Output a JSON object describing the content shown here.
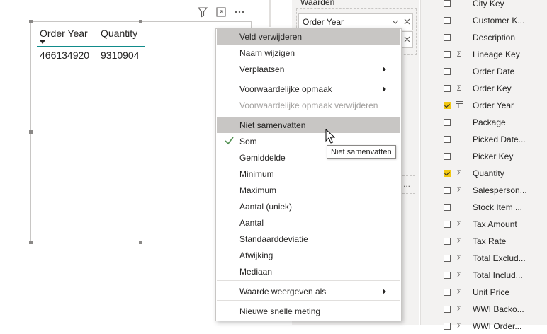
{
  "visual": {
    "columns": [
      "Order Year",
      "Quantity"
    ],
    "row": [
      "466134920",
      "9310904"
    ],
    "toolbar_icons": [
      "filter-icon",
      "focus-mode-icon",
      "more-options-icon"
    ]
  },
  "wells": {
    "section_label": "Waarden",
    "fields": [
      "Order Year",
      ""
    ],
    "drop_hint": "..."
  },
  "fields_pane": {
    "items": [
      {
        "name": "City Key",
        "checked": false,
        "type": ""
      },
      {
        "name": "Customer K...",
        "checked": false,
        "type": ""
      },
      {
        "name": "Description",
        "checked": false,
        "type": ""
      },
      {
        "name": "Lineage Key",
        "checked": false,
        "type": "Σ"
      },
      {
        "name": "Order Date",
        "checked": false,
        "type": ""
      },
      {
        "name": "Order Key",
        "checked": false,
        "type": "Σ"
      },
      {
        "name": "Order Year",
        "checked": true,
        "type": "table"
      },
      {
        "name": "Package",
        "checked": false,
        "type": ""
      },
      {
        "name": "Picked Date...",
        "checked": false,
        "type": ""
      },
      {
        "name": "Picker Key",
        "checked": false,
        "type": ""
      },
      {
        "name": "Quantity",
        "checked": true,
        "type": "Σ"
      },
      {
        "name": "Salesperson...",
        "checked": false,
        "type": "Σ"
      },
      {
        "name": "Stock Item ...",
        "checked": false,
        "type": ""
      },
      {
        "name": "Tax Amount",
        "checked": false,
        "type": "Σ"
      },
      {
        "name": "Tax Rate",
        "checked": false,
        "type": "Σ"
      },
      {
        "name": "Total Exclud...",
        "checked": false,
        "type": "Σ"
      },
      {
        "name": "Total Includ...",
        "checked": false,
        "type": "Σ"
      },
      {
        "name": "Unit Price",
        "checked": false,
        "type": "Σ"
      },
      {
        "name": "WWI Backo...",
        "checked": false,
        "type": "Σ"
      },
      {
        "name": "WWI Order...",
        "checked": false,
        "type": "Σ"
      }
    ]
  },
  "menu": {
    "items": [
      {
        "label": "Veld verwijderen",
        "highlighted": true
      },
      {
        "label": "Naam wijzigen"
      },
      {
        "label": "Verplaatsen",
        "submenu": true
      },
      {
        "label": "Voorwaardelijke opmaak",
        "submenu": true
      },
      {
        "label": "Voorwaardelijke opmaak verwijderen",
        "disabled": true
      },
      {
        "label": "Niet samenvatten",
        "highlighted": true
      },
      {
        "label": "Som",
        "checked": true
      },
      {
        "label": "Gemiddelde"
      },
      {
        "label": "Minimum"
      },
      {
        "label": "Maximum"
      },
      {
        "label": "Aantal (uniek)"
      },
      {
        "label": "Aantal"
      },
      {
        "label": "Standaarddeviatie"
      },
      {
        "label": "Afwijking"
      },
      {
        "label": "Mediaan"
      },
      {
        "label": "Waarde weergeven als",
        "submenu": true
      },
      {
        "label": "Nieuwe snelle meting"
      }
    ]
  },
  "tooltip": "Niet samenvatten",
  "colors": {
    "accent": "#118b8b",
    "checkbox_on": "#f2c811",
    "highlight": "#c8c6c4"
  }
}
